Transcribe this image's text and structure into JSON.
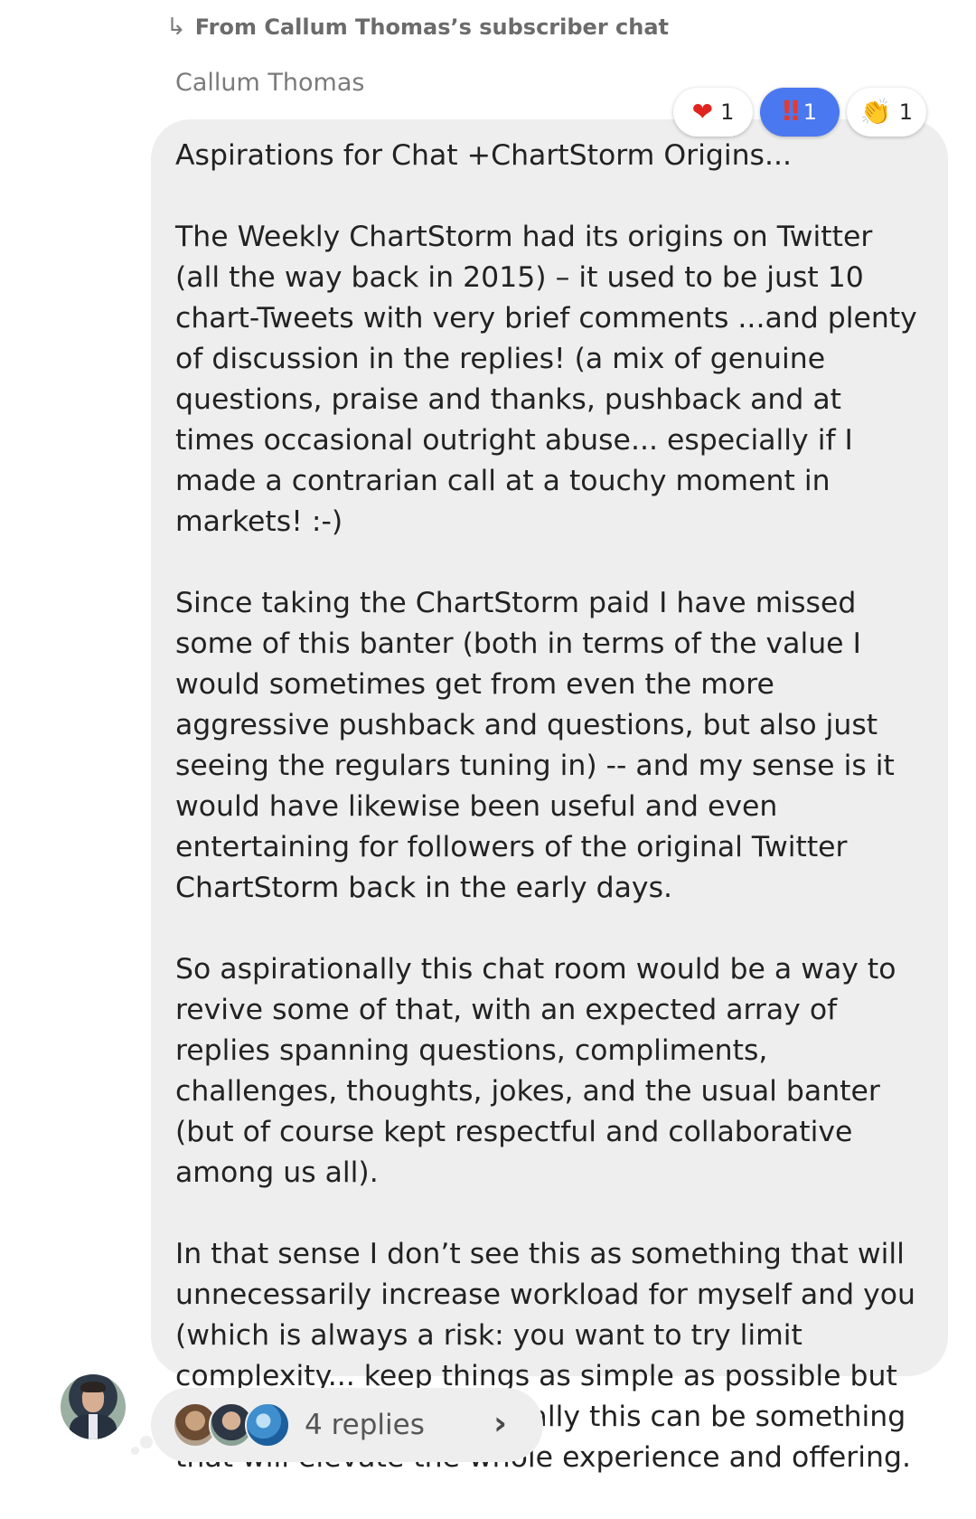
{
  "forwarded": {
    "label": "From Callum Thomas’s subscriber chat"
  },
  "message": {
    "sender": "Callum Thomas",
    "title": "Aspirations for Chat +ChartStorm Origins...",
    "paragraphs": [
      "The Weekly ChartStorm had its origins on Twitter (all the way back in 2015) – it used to be just 10 chart-Tweets with very brief comments ...and plenty of discussion in the replies! (a mix of genuine questions, praise and thanks, pushback and at times occasional outright abuse... especially if I made a contrarian call at a touchy moment in markets! :-)",
      "Since taking the ChartStorm paid I have missed some of this banter (both in terms of the value I would sometimes get from even the more aggressive pushback and questions, but also just seeing the regulars tuning in) -- and my sense is it would have likewise been useful and even entertaining for followers of the original Twitter ChartStorm back in the early days.",
      "So aspirationally this chat room would be a way to revive some of that, with an expected array of replies spanning questions, compliments, challenges, thoughts, jokes, and the usual banter (but of course kept respectful and collaborative among us all).",
      "In that sense I don’t see this as something that will unnecessarily increase workload for myself and you (which is always a risk: you want to try limit complexity... keep things as simple as possible but no simpler) --and potentially this can be something that will elevate the whole experience and offering."
    ]
  },
  "reactions": [
    {
      "icon": "heart-icon",
      "glyph": "❤",
      "count": "1",
      "active": false
    },
    {
      "icon": "double-exclamation-icon",
      "glyph": "‼",
      "count": "1",
      "active": true
    },
    {
      "icon": "clapping-hands-icon",
      "glyph": "👏",
      "count": "1",
      "active": false
    }
  ],
  "replies": {
    "label": "4 replies"
  },
  "colors": {
    "bubble": "#eeeeee",
    "active_reaction": "#4a78f0",
    "heart": "#e0241f"
  }
}
